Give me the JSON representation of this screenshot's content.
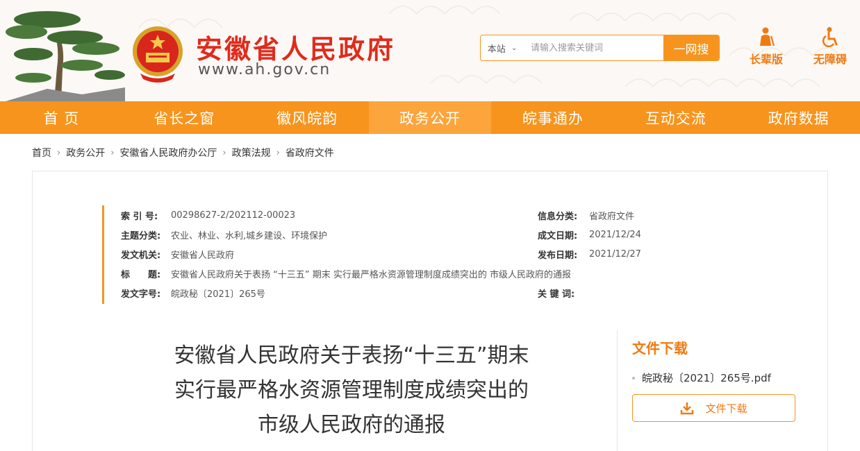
{
  "header": {
    "site_title": "安徽省人民政府",
    "site_url": "www.ah.gov.cn",
    "search": {
      "scope": "本站",
      "placeholder": "请输入搜索关键词",
      "button": "一网搜"
    },
    "tools": {
      "elder": "长辈版",
      "access": "无障碍"
    }
  },
  "nav": {
    "items": [
      {
        "label": "首 页"
      },
      {
        "label": "省长之窗"
      },
      {
        "label": "徽风皖韵"
      },
      {
        "label": "政务公开"
      },
      {
        "label": "皖事通办"
      },
      {
        "label": "互动交流"
      },
      {
        "label": "政府数据"
      }
    ],
    "active_index": 3
  },
  "breadcrumb": [
    "首页",
    "政务公开",
    "安徽省人民政府办公厅",
    "政策法规",
    "省政府文件"
  ],
  "meta": {
    "index_label": "索 引 号:",
    "index_value": "00298627-2/202112-00023",
    "topic_label": "主题分类:",
    "topic_value": "农业、林业、水利,城乡建设、环境保护",
    "issuer_label": "发文机关:",
    "issuer_value": "安徽省人民政府",
    "title_label": "标　　题:",
    "title_value": "安徽省人民政府关于表扬 “十三五” 期末 实行最严格水资源管理制度成绩突出的 市级人民政府的通报",
    "docno_label": "发文字号:",
    "docno_value": "皖政秘〔2021〕265号",
    "category_label": "信息分类:",
    "category_value": "省政府文件",
    "written_label": "成文日期:",
    "written_value": "2021/12/24",
    "published_label": "发布日期:",
    "published_value": "2021/12/27",
    "keywords_label": "关 键 词:"
  },
  "document": {
    "title_lines": [
      "安徽省人民政府关于表扬“十三五”期末",
      "实行最严格水资源管理制度成绩突出的",
      "市级人民政府的通报"
    ]
  },
  "download": {
    "title": "文件下载",
    "file_name": "皖政秘〔2021〕265号.pdf",
    "button": "文件下载"
  },
  "colors": {
    "accent": "#f7941d",
    "title_red": "#e02b1c"
  }
}
